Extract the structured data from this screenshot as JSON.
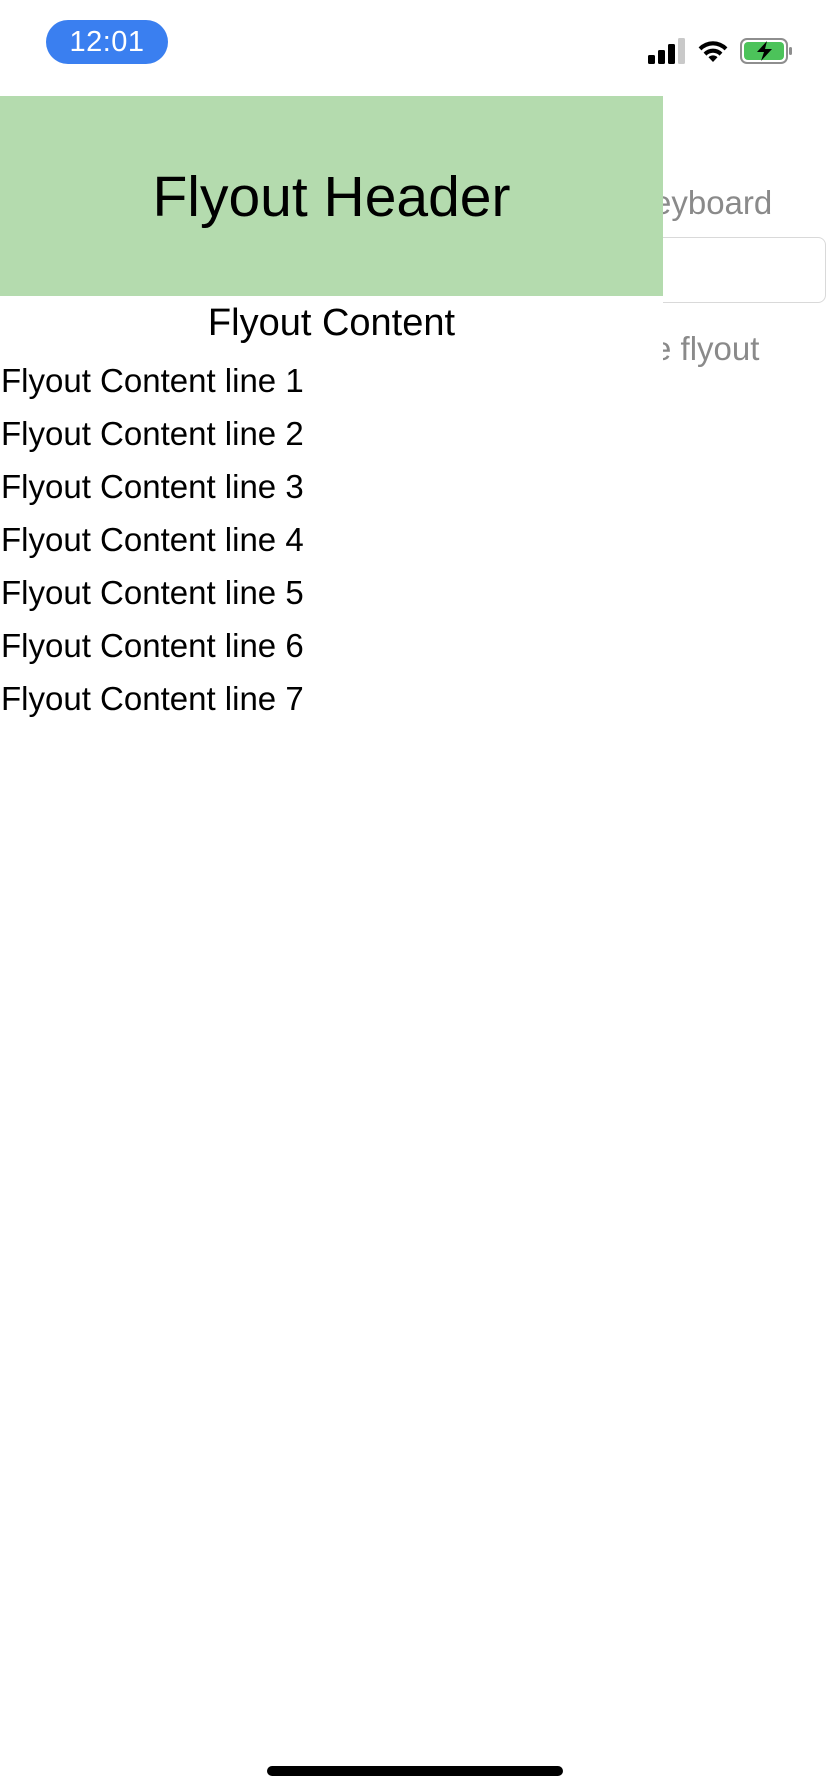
{
  "status_bar": {
    "time": "12:01",
    "icons": [
      "cellular-signal-icon",
      "wifi-icon",
      "battery-charging-icon"
    ]
  },
  "underlying_page": {
    "label_text": "eyboard",
    "entry_placeholder": "",
    "hint_text": "e flyout"
  },
  "flyout": {
    "header_title": "Flyout Header",
    "header_color": "#b4dbae",
    "content_title": "Flyout Content",
    "lines": [
      "Flyout Content line 1",
      "Flyout Content line 2",
      "Flyout Content line 3",
      "Flyout Content line 4",
      "Flyout Content line 5",
      "Flyout Content line 6",
      "Flyout Content line 7"
    ]
  },
  "colors": {
    "time_pill": "#3a7ff0",
    "battery_fill": "#4cc35a"
  }
}
